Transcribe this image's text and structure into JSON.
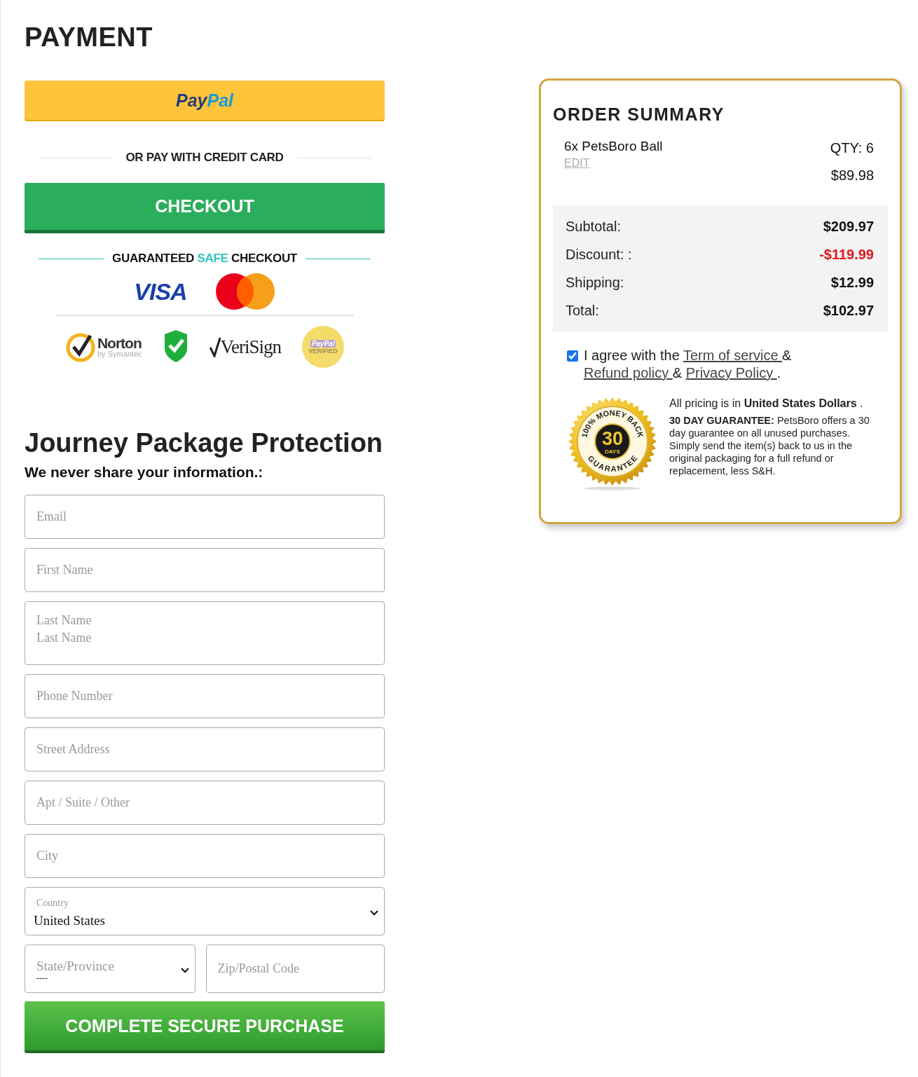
{
  "heading": "PAYMENT",
  "paypal_button": {
    "label_parts": [
      "Pay",
      "Pal"
    ]
  },
  "divider_text": "OR PAY WITH CREDIT CARD",
  "checkout_button": "CHECKOUT",
  "trust": {
    "title_before": "GUARANTEED",
    "title_highlight": "SAFE",
    "title_after": "CHECKOUT",
    "card_logos": [
      "VISA"
    ],
    "norton": {
      "name": "Norton",
      "sub": "by Symantec"
    },
    "verisign": "VeriSign",
    "paypal_seal": {
      "name": "PayPal",
      "sub": "VERIFIED"
    }
  },
  "protection": {
    "title": "Journey Package Protection",
    "subtitle": "We never share your information.:"
  },
  "fields": [
    {
      "kind": "input",
      "placeholder": "Email"
    },
    {
      "kind": "input",
      "placeholder": "First Name"
    },
    {
      "kind": "labeled",
      "label": "Last Name",
      "placeholder": "Last Name"
    },
    {
      "kind": "input",
      "placeholder": "Phone Number"
    },
    {
      "kind": "input",
      "placeholder": "Street Address"
    },
    {
      "kind": "input",
      "placeholder": "Apt / Suite / Other"
    },
    {
      "kind": "input",
      "placeholder": "City"
    },
    {
      "kind": "select",
      "label": "Country",
      "value": "United States"
    }
  ],
  "split_row": [
    {
      "kind": "select-hint",
      "placeholder": "State/Province",
      "value": "----"
    },
    {
      "kind": "input",
      "placeholder": "Zip/Postal Code"
    }
  ],
  "purchase_button": "COMPLETE SECURE PURCHASE",
  "order_summary": {
    "title": "ORDER SUMMARY",
    "item": {
      "name": "6x PetsBoro Ball",
      "edit": "EDIT",
      "qty": "QTY: 6",
      "price": "$89.98"
    },
    "totals": [
      {
        "label": "Subtotal:",
        "value": "$209.97",
        "kind": "normal"
      },
      {
        "label": "Discount: :",
        "value": "-$119.99",
        "kind": "discount"
      },
      {
        "label": "Shipping:",
        "value": "$12.99",
        "kind": "normal"
      },
      {
        "label": "Total:",
        "value": "$102.97",
        "kind": "normal"
      }
    ],
    "agreement": {
      "checked": true,
      "text": "I agree with the",
      "links": [
        "Term of service ",
        "Refund policy ",
        "Privacy Policy "
      ],
      "separators": [
        "&",
        "&",
        "."
      ]
    },
    "seal": {
      "top": "100% MONEY BACK",
      "number": "30",
      "unit": "DAYS",
      "bottom": "GUARANTEE"
    },
    "pricing_note": "All pricing is in **United States Dollars** .",
    "guarantee_text": "**30 DAY GUARANTEE:** PetsBoro offers a 30 day guarantee on all unused purchases. Simply send the item(s) back to us in the original packaging for a full refund or replacement, less S&H."
  }
}
